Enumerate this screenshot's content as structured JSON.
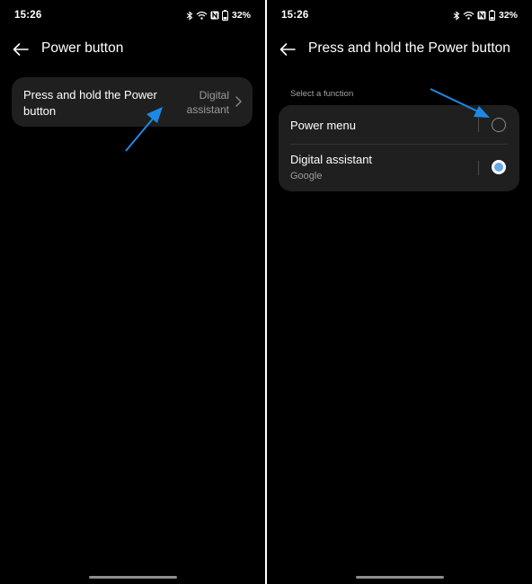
{
  "left_screen": {
    "status_bar": {
      "time": "15:26",
      "battery": "32%"
    },
    "header": {
      "title": "Power button"
    },
    "setting": {
      "title": "Press and hold the Power button",
      "value": "Digital assistant"
    }
  },
  "right_screen": {
    "status_bar": {
      "time": "15:26",
      "battery": "32%"
    },
    "header": {
      "title": "Press and hold the Power button"
    },
    "section_label": "Select a function",
    "options": [
      {
        "label": "Power menu",
        "sublabel": "",
        "selected": false
      },
      {
        "label": "Digital assistant",
        "sublabel": "Google",
        "selected": true
      }
    ]
  },
  "colors": {
    "background": "#000000",
    "card": "#1f1f1f",
    "radio_selected": "#6aa7e6",
    "annotation_arrow": "#1e88e5"
  },
  "icons": [
    "back-arrow-icon",
    "chevron-right-icon",
    "bluetooth-icon",
    "wifi-icon",
    "nfc-icon",
    "battery-icon"
  ]
}
